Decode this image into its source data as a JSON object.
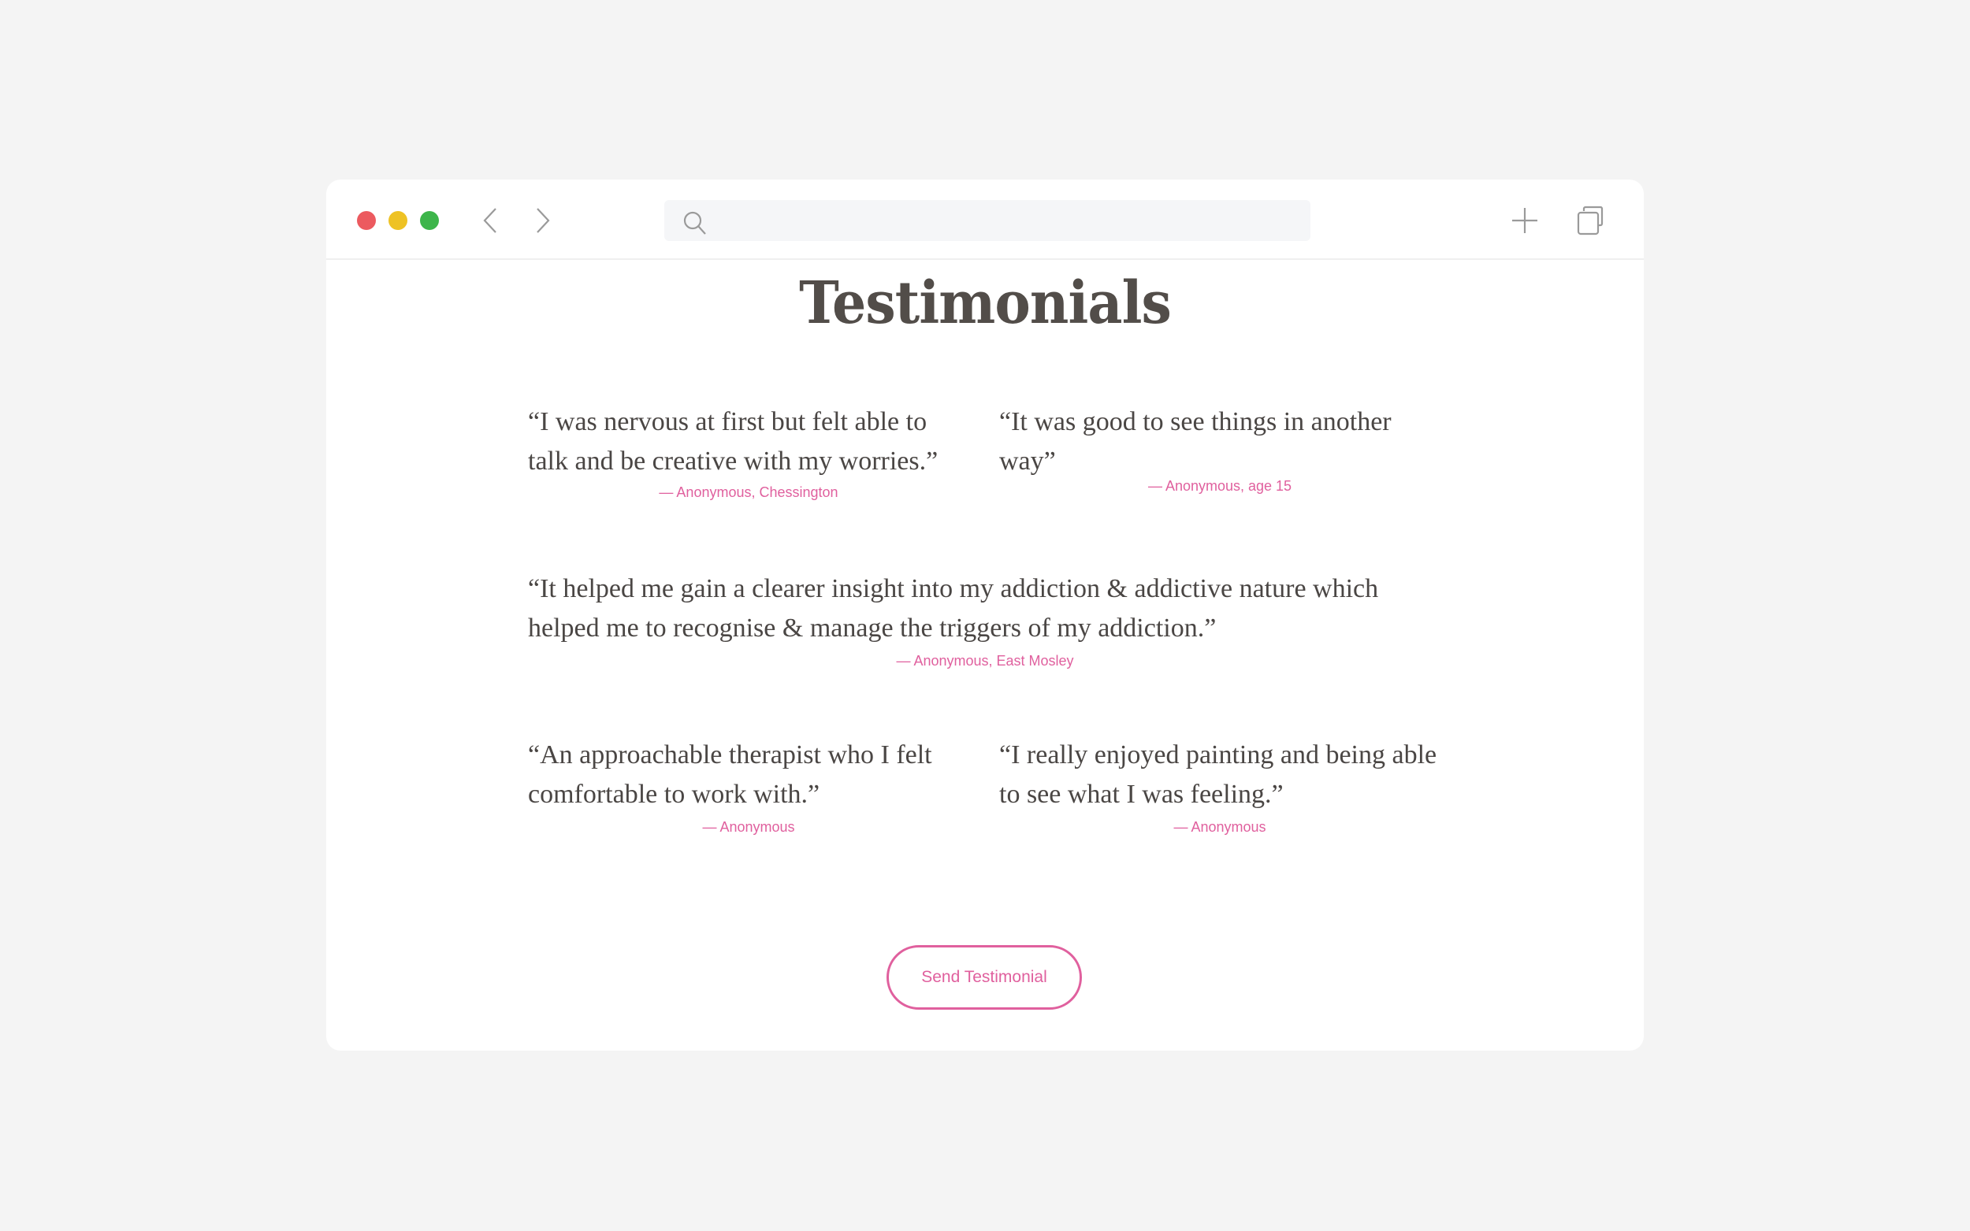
{
  "browser": {
    "traffic_lights": [
      {
        "name": "close",
        "color": "#ec5a5f"
      },
      {
        "name": "minimize",
        "color": "#eec224"
      },
      {
        "name": "maximize",
        "color": "#3db54a"
      }
    ],
    "nav": {
      "back_icon": "chevron-left-icon",
      "forward_icon": "chevron-right-icon"
    },
    "search": {
      "icon": "search-icon",
      "value": "",
      "placeholder": ""
    },
    "actions": {
      "new_tab_icon": "plus-icon",
      "tabs_icon": "tabs-icon"
    }
  },
  "page": {
    "title": "Testimonials",
    "testimonials": [
      {
        "quote": "“I was nervous at first but felt able to talk and be creative with my worries.”",
        "attribution": "— Anonymous, Chessington"
      },
      {
        "quote": "“It was good to see things in another way”",
        "attribution": "— Anonymous, age 15"
      },
      {
        "quote": "“It helped me gain a clearer insight into my addiction & addictive nature which helped me to recognise & manage the triggers of my addiction.”",
        "attribution": "— Anonymous, East Mosley"
      },
      {
        "quote": "“An approachable therapist who I felt comfortable to work with.”",
        "attribution": "— Anonymous"
      },
      {
        "quote": "“I really enjoyed painting and being able to see what I was feeling.”",
        "attribution": "— Anonymous"
      }
    ],
    "send_button_label": "Send Testimonial"
  },
  "colors": {
    "background": "#f4f4f4",
    "window": "#ffffff",
    "text": "#4a4644",
    "title": "#524d49",
    "accent": "#e0609e",
    "icon": "#9a9a9a"
  }
}
